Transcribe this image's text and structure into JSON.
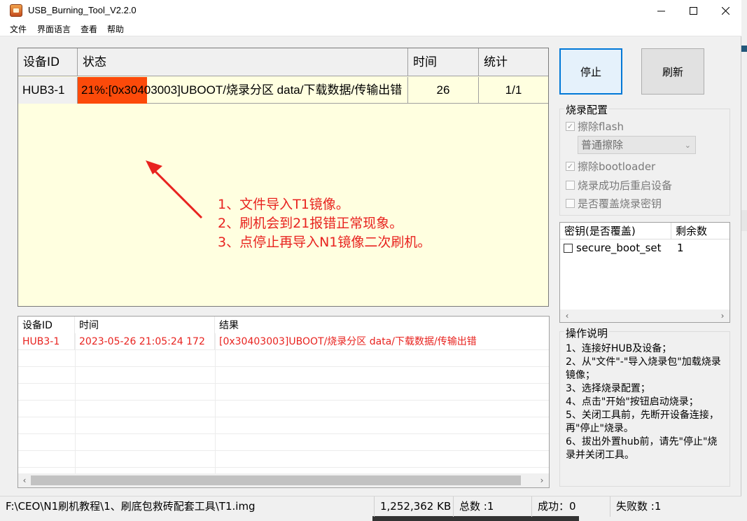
{
  "window": {
    "title": "USB_Burning_Tool_V2.2.0"
  },
  "menu": [
    "文件",
    "界面语言",
    "查看",
    "帮助"
  ],
  "device_table": {
    "headers": [
      "设备ID",
      "状态",
      "时间",
      "统计"
    ],
    "row": {
      "device_id": "HUB3-1",
      "status": "21%:[0x30403003]UBOOT/烧录分区 data/下载数据/传输出错",
      "progress_percent": 21,
      "progress_color": "#fc4a0a",
      "time": "26",
      "count": "1/1"
    }
  },
  "annotation": {
    "lines": [
      "1、文件导入T1镜像。",
      "2、刷机会到21报错正常现象。",
      "3、点停止再导入N1镜像二次刷机。"
    ],
    "color": "#e8231f"
  },
  "log_table": {
    "headers": [
      "设备ID",
      "时间",
      "结果"
    ],
    "rows": [
      {
        "device_id": "HUB3-1",
        "time": "2023-05-26 21:05:24 172",
        "result": "[0x30403003]UBOOT/烧录分区 data/下载数据/传输出错"
      }
    ]
  },
  "buttons": {
    "stop": "停止",
    "refresh": "刷新"
  },
  "burn_config": {
    "title": "烧录配置",
    "erase_flash": "擦除flash",
    "erase_mode": "普通擦除",
    "erase_bootloader": "擦除bootloader",
    "reboot_after": "烧录成功后重启设备",
    "overwrite_key": "是否覆盖烧录密钥"
  },
  "key_table": {
    "headers": [
      "密钥(是否覆盖)",
      "剩余数"
    ],
    "rows": [
      {
        "name": "secure_boot_set",
        "remaining": "1"
      }
    ]
  },
  "instructions": {
    "title": "操作说明",
    "text": "1、连接好HUB及设备；\n2、从\"文件\"-\"导入烧录包\"加载烧录镜像；\n3、选择烧录配置；\n4、点击\"开始\"按钮启动烧录；\n5、关闭工具前，先断开设备连接，再\"停止\"烧录。\n6、拔出外置hub前，请先\"停止\"烧录并关闭工具。"
  },
  "status_bar": {
    "path": "F:\\CEO\\N1刷机教程\\1、刷底包救砖配套工具\\T1.img",
    "size": "1,252,362 KB",
    "total": "总数 :1",
    "success": "成功：0",
    "fail": "失败数 :1"
  }
}
